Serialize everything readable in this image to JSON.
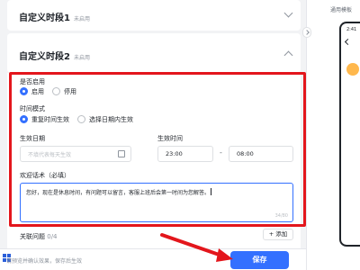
{
  "periods": [
    {
      "title": "自定义时段1",
      "status": "未启用"
    },
    {
      "title": "自定义时段2",
      "status": "未启用"
    }
  ],
  "form": {
    "enable": {
      "label": "是否启用",
      "options": [
        "启用",
        "停用"
      ],
      "selected": "启用"
    },
    "time_mode": {
      "label": "时间模式",
      "options": [
        "重复时间生效",
        "选择日期内生效"
      ],
      "selected": "重复时间生效"
    },
    "effective_date": {
      "label": "生效日期",
      "placeholder": "不填代表每天生效"
    },
    "effective_time": {
      "label": "生效时间",
      "start": "23:00",
      "separator": "-",
      "end": "08:00"
    },
    "greeting": {
      "label": "欢迎话术（必填）",
      "value": "您好，现在是休息时间，有问题可以留言，客服上班后会第一时间为您解答。",
      "count": "34/80"
    },
    "related_questions": {
      "label": "关联问题",
      "count": "0/4"
    },
    "add_button": "+ 添加"
  },
  "footer": {
    "note": "请预览并确认效果，保存后生效",
    "save_label": "保存"
  },
  "preview": {
    "title": "通用模板",
    "phone_time": "2:41"
  },
  "colors": {
    "accent": "#3370ff",
    "highlight_red": "#e3161c"
  },
  "icons": [
    "chevron-down-icon",
    "chevron-up-icon",
    "calendar-icon",
    "clock-icon",
    "red-arrow-annotation",
    "collapse-arrow-icon"
  ]
}
